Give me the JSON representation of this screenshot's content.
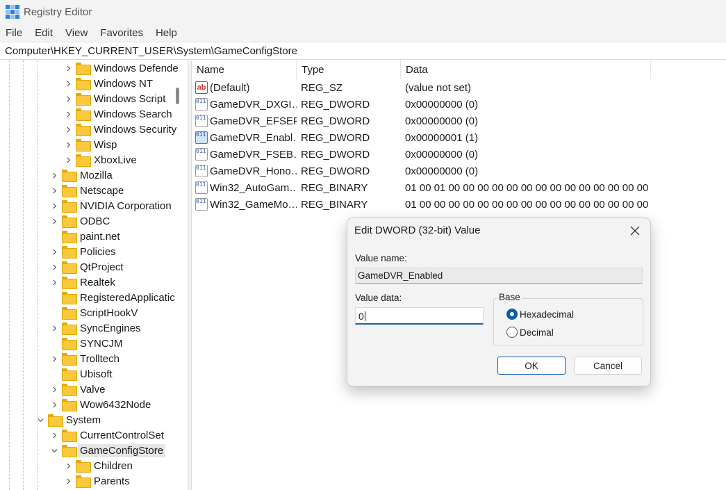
{
  "window": {
    "title": "Registry Editor"
  },
  "menu": [
    "File",
    "Edit",
    "View",
    "Favorites",
    "Help"
  ],
  "address": "Computer\\HKEY_CURRENT_USER\\System\\GameConfigStore",
  "tree": {
    "nodes": [
      {
        "label": "Windows Defende",
        "icon": "folder-icon",
        "expander": "chevron-right-icon"
      },
      {
        "label": "Windows NT",
        "icon": "folder-icon",
        "expander": "chevron-right-icon"
      },
      {
        "label": "Windows Script",
        "icon": "folder-icon",
        "expander": "chevron-right-icon"
      },
      {
        "label": "Windows Search",
        "icon": "folder-icon",
        "expander": "chevron-right-icon"
      },
      {
        "label": "Windows Security",
        "icon": "folder-icon",
        "expander": "chevron-right-icon"
      },
      {
        "label": "Wisp",
        "icon": "folder-icon",
        "expander": "chevron-right-icon"
      },
      {
        "label": "XboxLive",
        "icon": "folder-icon",
        "expander": "chevron-right-icon"
      },
      {
        "label": "Mozilla",
        "icon": "folder-icon",
        "expander": "chevron-right-icon"
      },
      {
        "label": "Netscape",
        "icon": "folder-icon",
        "expander": "chevron-right-icon"
      },
      {
        "label": "NVIDIA Corporation",
        "icon": "folder-icon",
        "expander": "chevron-right-icon"
      },
      {
        "label": "ODBC",
        "icon": "folder-icon",
        "expander": "chevron-right-icon"
      },
      {
        "label": "paint.net",
        "icon": "folder-icon",
        "expander": ""
      },
      {
        "label": "Policies",
        "icon": "folder-icon",
        "expander": "chevron-right-icon"
      },
      {
        "label": "QtProject",
        "icon": "folder-icon",
        "expander": "chevron-right-icon"
      },
      {
        "label": "Realtek",
        "icon": "folder-icon",
        "expander": "chevron-right-icon"
      },
      {
        "label": "RegisteredApplicatic",
        "icon": "folder-icon",
        "expander": ""
      },
      {
        "label": "ScriptHookV",
        "icon": "folder-icon",
        "expander": ""
      },
      {
        "label": "SyncEngines",
        "icon": "folder-icon",
        "expander": "chevron-right-icon"
      },
      {
        "label": "SYNCJM",
        "icon": "folder-icon",
        "expander": ""
      },
      {
        "label": "Trolltech",
        "icon": "folder-icon",
        "expander": "chevron-right-icon"
      },
      {
        "label": "Ubisoft",
        "icon": "folder-icon",
        "expander": ""
      },
      {
        "label": "Valve",
        "icon": "folder-icon",
        "expander": "chevron-right-icon"
      },
      {
        "label": "Wow6432Node",
        "icon": "folder-icon",
        "expander": "chevron-right-icon"
      },
      {
        "label": "System",
        "icon": "folder-icon",
        "expander": "chevron-down-icon"
      },
      {
        "label": "CurrentControlSet",
        "icon": "folder-icon",
        "expander": "chevron-right-icon"
      },
      {
        "label": "GameConfigStore",
        "icon": "folder-icon",
        "expander": "chevron-down-icon",
        "selected": true
      },
      {
        "label": "Children",
        "icon": "folder-icon",
        "expander": "chevron-right-icon"
      },
      {
        "label": "Parents",
        "icon": "folder-icon",
        "expander": "chevron-right-icon"
      }
    ]
  },
  "list": {
    "columns": [
      "Name",
      "Type",
      "Data"
    ],
    "rows": [
      {
        "name": "(Default)",
        "type": "REG_SZ",
        "data": "(value not set)",
        "icon": "string-value-icon"
      },
      {
        "name": "GameDVR_DXGI…",
        "type": "REG_DWORD",
        "data": "0x00000000 (0)",
        "icon": "binary-value-icon"
      },
      {
        "name": "GameDVR_EFSEF…",
        "type": "REG_DWORD",
        "data": "0x00000000 (0)",
        "icon": "binary-value-icon"
      },
      {
        "name": "GameDVR_Enabl…",
        "type": "REG_DWORD",
        "data": "0x00000001 (1)",
        "icon": "binary-value-icon",
        "highlight": true
      },
      {
        "name": "GameDVR_FSEB…",
        "type": "REG_DWORD",
        "data": "0x00000000 (0)",
        "icon": "binary-value-icon"
      },
      {
        "name": "GameDVR_Hono…",
        "type": "REG_DWORD",
        "data": "0x00000000 (0)",
        "icon": "binary-value-icon"
      },
      {
        "name": "Win32_AutoGam…",
        "type": "REG_BINARY",
        "data": "01 00 01 00 00 00 00 00 00 00 00 00 00 00 00 00 00 00…",
        "icon": "binary-value-icon"
      },
      {
        "name": "Win32_GameMo…",
        "type": "REG_BINARY",
        "data": "01 00 00 00 00 00 00 00 00 00 00 00 00 00 00 00 00 00…",
        "icon": "binary-value-icon"
      }
    ]
  },
  "dialog": {
    "title": "Edit DWORD (32-bit) Value",
    "value_name_label": "Value name:",
    "value_name": "GameDVR_Enabled",
    "value_data_label": "Value data:",
    "value_data": "0",
    "base_label": "Base",
    "base_options": [
      {
        "label": "Hexadecimal",
        "selected": true
      },
      {
        "label": "Decimal",
        "selected": false
      }
    ],
    "ok_label": "OK",
    "cancel_label": "Cancel"
  },
  "colors": {
    "accent": "#0b5cad",
    "folder": "#f9c83c",
    "selection": "#e5e5e5"
  }
}
